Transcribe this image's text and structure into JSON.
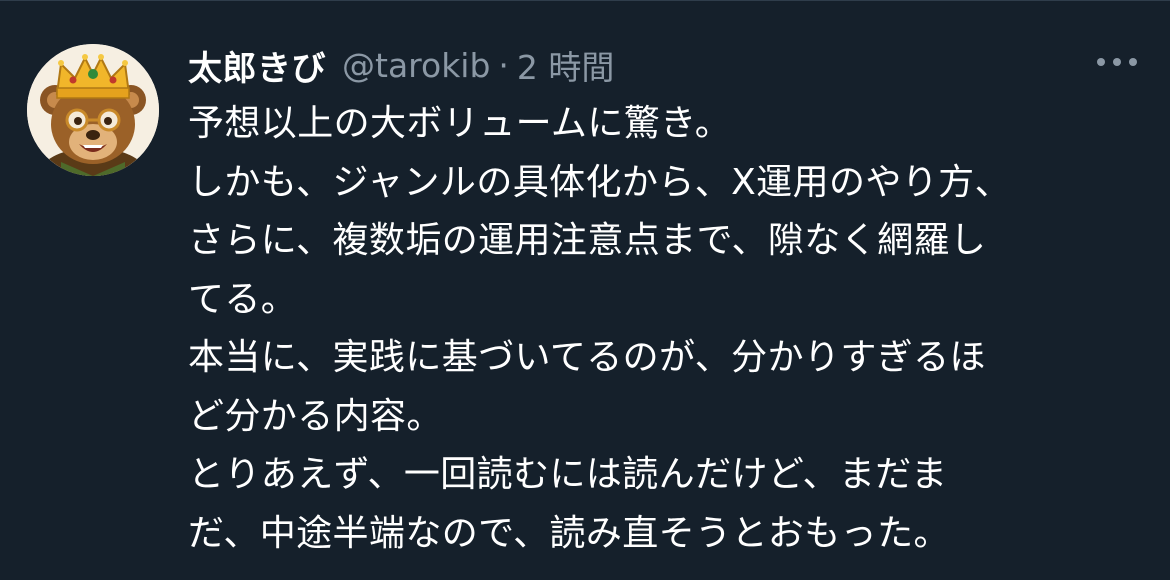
{
  "tweet": {
    "author": {
      "display_name": "太郎きび",
      "handle": "@tarokib",
      "avatar_icon": "bear-with-crown-avatar"
    },
    "separator": "·",
    "time": "2 時間",
    "more_icon": "more-icon",
    "text_lines": [
      "予想以上の大ボリュームに驚き。",
      "しかも、ジャンルの具体化から、X運用のやり方、",
      "さらに、複数垢の運用注意点まで、隙なく網羅し",
      "てる。",
      "本当に、実践に基づいてるのが、分かりすぎるほ",
      "ど分かる内容。",
      "とりあえず、一回読むには読んだけど、まだま",
      "だ、中途半端なので、読み直そうとおもった。"
    ]
  },
  "colors": {
    "background": "#15202b",
    "primary_text": "#ffffff",
    "secondary_text": "#8b98a5"
  }
}
